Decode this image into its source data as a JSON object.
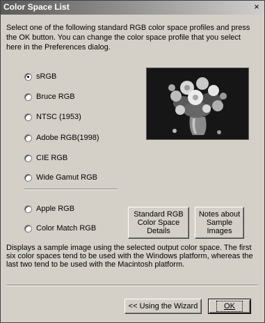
{
  "window": {
    "title": "Color Space List",
    "close_glyph": "×"
  },
  "intro_text": "Select one of the following standard RGB color space profiles and press the OK button. You can change the color space profile that you select here in the Preferences dialog.",
  "color_spaces": [
    {
      "label": "sRGB",
      "checked": true
    },
    {
      "label": "Bruce RGB",
      "checked": false
    },
    {
      "label": "NTSC (1953)",
      "checked": false
    },
    {
      "label": "Adobe RGB(1998)",
      "checked": false
    },
    {
      "label": "CIE RGB",
      "checked": false
    },
    {
      "label": "Wide Gamut RGB",
      "checked": false
    },
    {
      "label": "Apple RGB",
      "checked": false
    },
    {
      "label": "Color Match RGB",
      "checked": false
    }
  ],
  "buttons": {
    "standard_rgb_details": "Standard RGB Color Space Details",
    "notes_sample": "Notes about Sample Images",
    "wizard": "<< Using the Wizard",
    "ok": "OK"
  },
  "description": "Displays a sample image using the selected output color space. The first six color spaces tend to be used with the Windows platform, whereas the last two tend to be used with the Macintosh platform."
}
